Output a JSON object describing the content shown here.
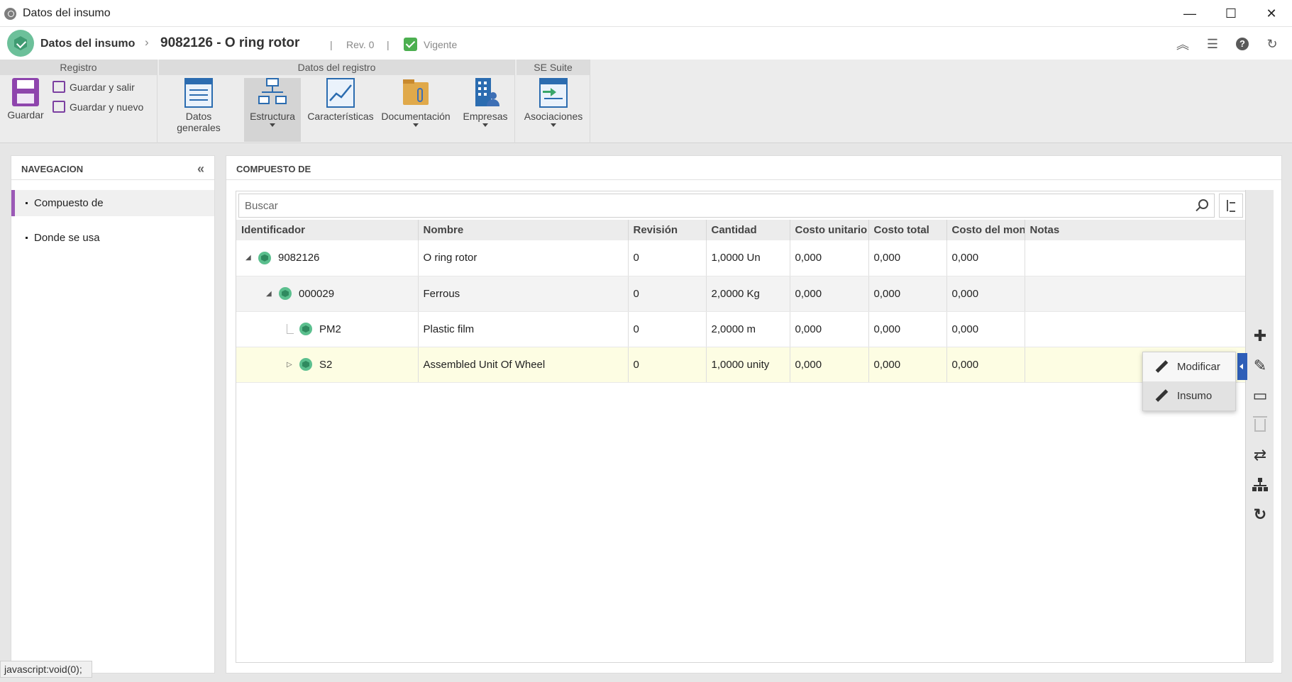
{
  "window": {
    "title": "Datos del insumo",
    "controls": {
      "minimize": "—",
      "maximize": "☐",
      "close": "✕"
    }
  },
  "header": {
    "module": "Datos del insumo",
    "separator": "›",
    "record": "9082126 - O ring rotor",
    "pipe": "|",
    "revision": "Rev. 0",
    "status": "Vigente",
    "icons": [
      "collapse-up-icon",
      "list-icon",
      "help-icon",
      "refresh-icon"
    ]
  },
  "ribbon": {
    "groups": {
      "registro": "Registro",
      "datos_registro": "Datos del registro",
      "se_suite": "SE Suite"
    },
    "buttons": {
      "guardar": "Guardar",
      "guardar_salir": "Guardar y salir",
      "guardar_nuevo": "Guardar y nuevo",
      "datos_generales": "Datos generales",
      "estructura": "Estructura",
      "caracteristicas": "Características",
      "documentacion": "Documentación",
      "empresas": "Empresas",
      "asociaciones": "Asociaciones"
    }
  },
  "nav": {
    "title": "NAVEGACION",
    "collapse": "«",
    "items": [
      {
        "label": "Compuesto de"
      },
      {
        "label": "Donde se usa"
      }
    ]
  },
  "panel": {
    "title": "COMPUESTO DE",
    "search_placeholder": "Buscar"
  },
  "table": {
    "columns": [
      "Identificador",
      "Nombre",
      "Revisión",
      "Cantidad",
      "Costo unitario",
      "Costo total",
      "Costo del monta",
      "Notas"
    ],
    "rows": [
      {
        "id": "9082126",
        "toggle": "◢",
        "name": "O ring rotor",
        "rev": "0",
        "qty": "1,0000 Un",
        "unit": "0,000",
        "total": "0,000",
        "mount": "0,000",
        "notes": ""
      },
      {
        "id": "000029",
        "toggle": "◢",
        "name": "Ferrous",
        "rev": "0",
        "qty": "2,0000 Kg",
        "unit": "0,000",
        "total": "0,000",
        "mount": "0,000",
        "notes": ""
      },
      {
        "id": "PM2",
        "toggle": "",
        "name": "Plastic film",
        "rev": "0",
        "qty": "2,0000 m",
        "unit": "0,000",
        "total": "0,000",
        "mount": "0,000",
        "notes": ""
      },
      {
        "id": "S2",
        "toggle": "▷",
        "name": "Assembled Unit Of Wheel",
        "rev": "0",
        "qty": "1,0000 unity",
        "unit": "0,000",
        "total": "0,000",
        "mount": "0,000",
        "notes": ""
      }
    ]
  },
  "popup": {
    "items": [
      "Modificar",
      "Insumo"
    ]
  },
  "toolbar_icons": {
    "add": "✚",
    "edit": "✎",
    "view": "▭",
    "delete": "🗑",
    "swap": "⇄",
    "hierarchy": "⊥",
    "reload": "↻"
  },
  "statusbar": "javascript:void(0);",
  "colors": {
    "accent_purple": "#9b59b6",
    "status_green": "#4caf50",
    "selection_blue": "#2f5fb8",
    "selected_row": "#fdfde3"
  }
}
